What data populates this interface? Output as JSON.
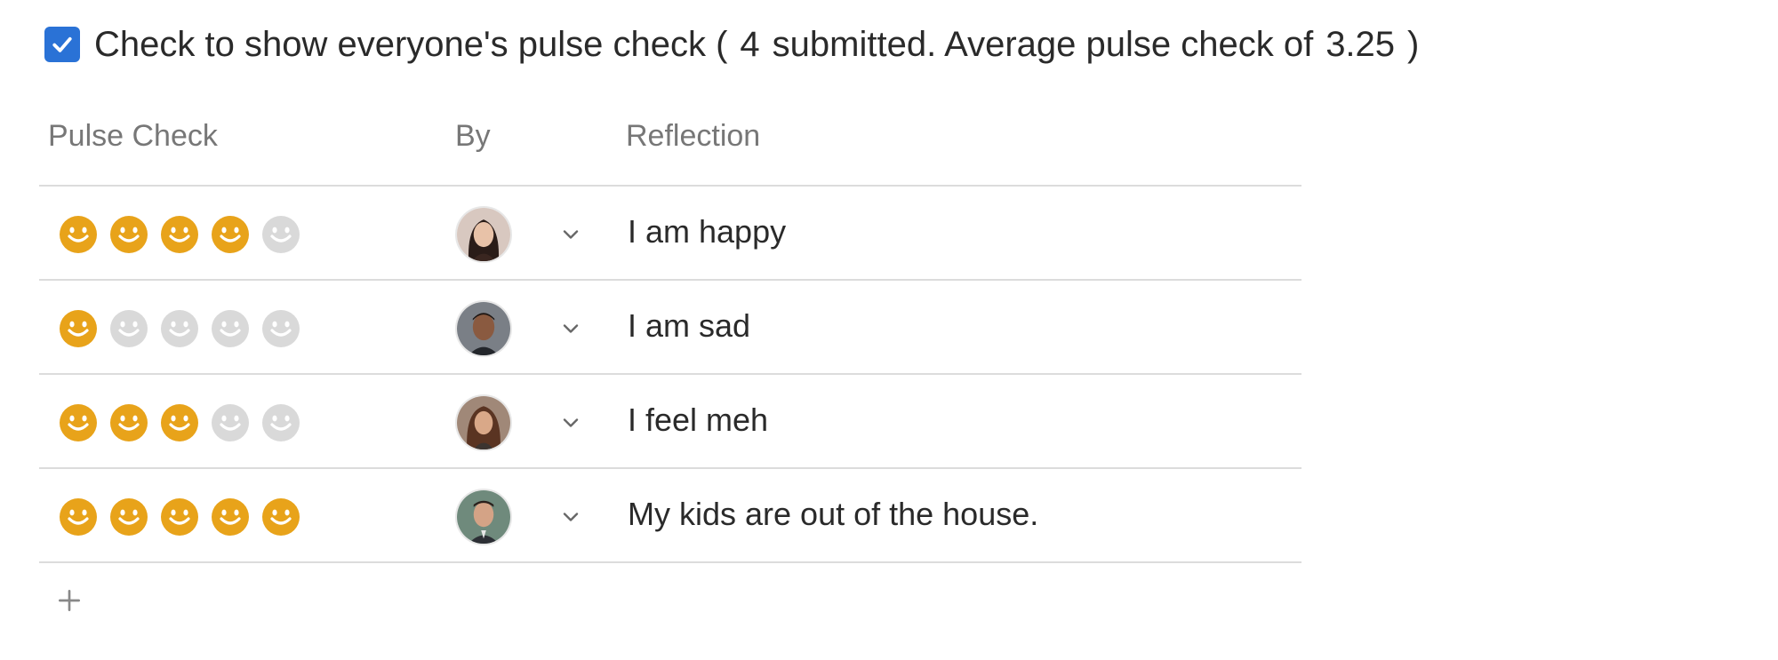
{
  "header": {
    "checkbox_checked": true,
    "label_prefix": "Check to show everyone's pulse check (",
    "submitted_count": "4",
    "label_middle": "submitted. Average pulse check of",
    "average": "3.25",
    "label_suffix": ")"
  },
  "table": {
    "columns": [
      "Pulse Check",
      "By",
      "Reflection"
    ],
    "rows": [
      {
        "rating": 4,
        "reflection": "I am happy",
        "avatar_icon": "avatar-icon"
      },
      {
        "rating": 1,
        "reflection": "I am sad",
        "avatar_icon": "avatar-icon"
      },
      {
        "rating": 3,
        "reflection": "I feel meh",
        "avatar_icon": "avatar-icon"
      },
      {
        "rating": 5,
        "reflection": "My kids are out of the house.",
        "avatar_icon": "avatar-icon"
      }
    ],
    "max_rating": 5
  },
  "icons": {
    "checkbox": "checkmark-icon",
    "face": "smiley-face-icon",
    "dropdown": "chevron-down-icon",
    "add": "plus-icon"
  },
  "colors": {
    "accent": "#2a72d6",
    "face_active": "#e8a31a",
    "face_inactive": "#d9d9d9",
    "divider": "#dcdcdc"
  }
}
